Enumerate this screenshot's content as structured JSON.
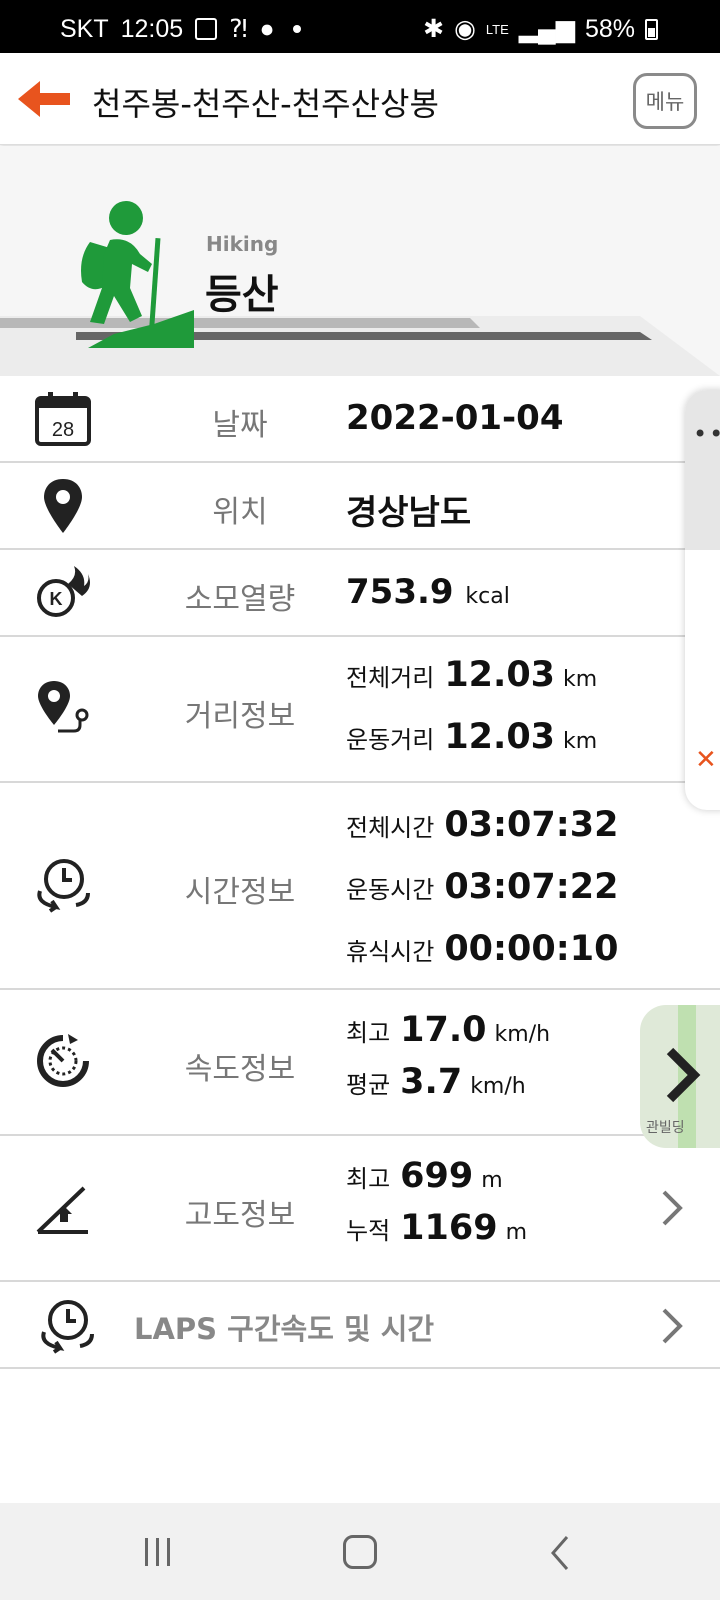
{
  "status_bar": {
    "carrier": "SKT",
    "time": "12:05",
    "network": "LTE",
    "battery": "58%"
  },
  "header": {
    "title": "천주봉-천주산-천주산상봉",
    "menu_label": "메뉴"
  },
  "activity": {
    "type_en": "Hiking",
    "type_ko": "등산"
  },
  "rows": {
    "date": {
      "label": "날짜",
      "value": "2022-01-04",
      "icon_text": "28"
    },
    "location": {
      "label": "위치",
      "value": "경상남도"
    },
    "calories": {
      "label": "소모열량",
      "value": "753.9",
      "unit": "kcal"
    },
    "distance": {
      "label": "거리정보",
      "total_label": "전체거리",
      "total_value": "12.03",
      "total_unit": "km",
      "moving_label": "운동거리",
      "moving_value": "12.03",
      "moving_unit": "km"
    },
    "time": {
      "label": "시간정보",
      "total_label": "전체시간",
      "total_value": "03:07:32",
      "moving_label": "운동시간",
      "moving_value": "03:07:22",
      "rest_label": "휴식시간",
      "rest_value": "00:00:10"
    },
    "speed": {
      "label": "속도정보",
      "max_label": "최고",
      "max_value": "17.0",
      "max_unit": "km/h",
      "avg_label": "평균",
      "avg_value": "3.7",
      "avg_unit": "km/h"
    },
    "altitude": {
      "label": "고도정보",
      "max_label": "최고",
      "max_value": "699",
      "max_unit": "m",
      "cum_label": "누적",
      "cum_value": "1169",
      "cum_unit": "m"
    },
    "laps": {
      "label": "LAPS 구간속도 및 시간"
    }
  },
  "map_thumb": {
    "text": "관빌딩"
  },
  "colors": {
    "accent": "#e8541e",
    "hiker_green": "#1f9a3a"
  }
}
